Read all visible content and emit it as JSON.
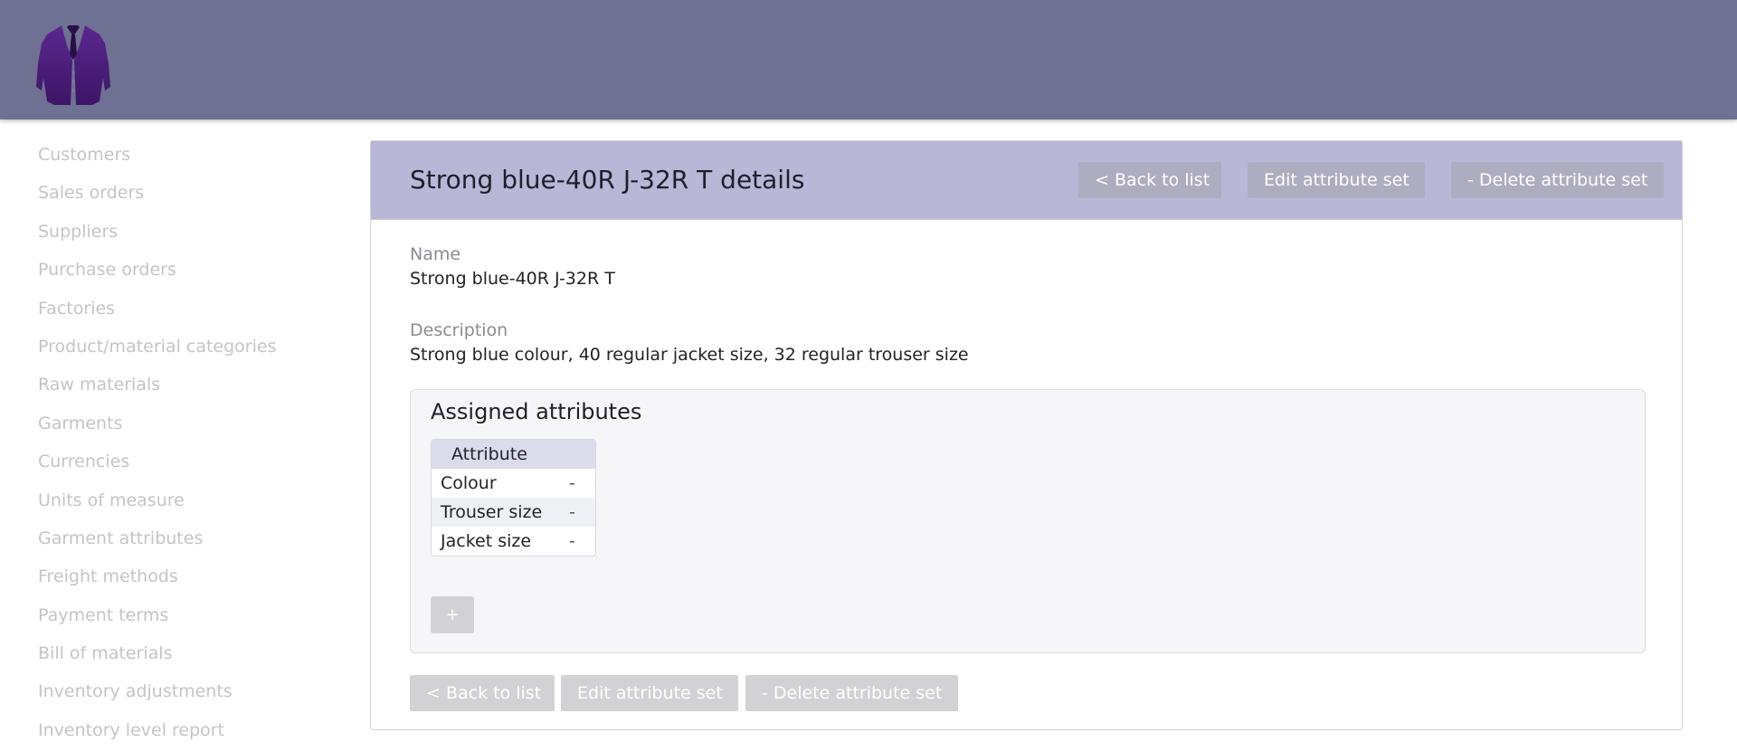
{
  "app": {
    "logo_name": "jacket-logo"
  },
  "sidebar": {
    "items": [
      {
        "label": "Customers"
      },
      {
        "label": "Sales orders"
      },
      {
        "label": "Suppliers"
      },
      {
        "label": "Purchase orders"
      },
      {
        "label": "Factories"
      },
      {
        "label": "Product/material categories"
      },
      {
        "label": "Raw materials"
      },
      {
        "label": "Garments"
      },
      {
        "label": "Currencies"
      },
      {
        "label": "Units of measure"
      },
      {
        "label": "Garment attributes"
      },
      {
        "label": "Freight methods"
      },
      {
        "label": "Payment terms"
      },
      {
        "label": "Bill of materials"
      },
      {
        "label": "Inventory adjustments"
      },
      {
        "label": "Inventory level report"
      }
    ]
  },
  "panel": {
    "title": "Strong blue-40R J-32R T details",
    "header_buttons": {
      "back": "< Back to list",
      "edit": "Edit attribute set",
      "delete": "- Delete attribute set"
    },
    "fields": {
      "name_label": "Name",
      "name_value": "Strong blue-40R J-32R T",
      "description_label": "Description",
      "description_value": "Strong blue colour, 40 regular jacket size, 32 regular trouser size"
    },
    "assigned": {
      "title": "Assigned attributes",
      "column_header": "Attribute",
      "rows": [
        {
          "name": "Colour",
          "action": "-"
        },
        {
          "name": "Trouser size",
          "action": "-"
        },
        {
          "name": "Jacket size",
          "action": "-"
        }
      ],
      "add_label": "+"
    },
    "footer_buttons": {
      "back": "< Back to list",
      "edit": "Edit attribute set",
      "delete": "- Delete attribute set"
    }
  },
  "colors": {
    "topbar": "#6e7191",
    "panel_header": "#b9b7d8",
    "logo_purple": "#4a1a7a"
  }
}
